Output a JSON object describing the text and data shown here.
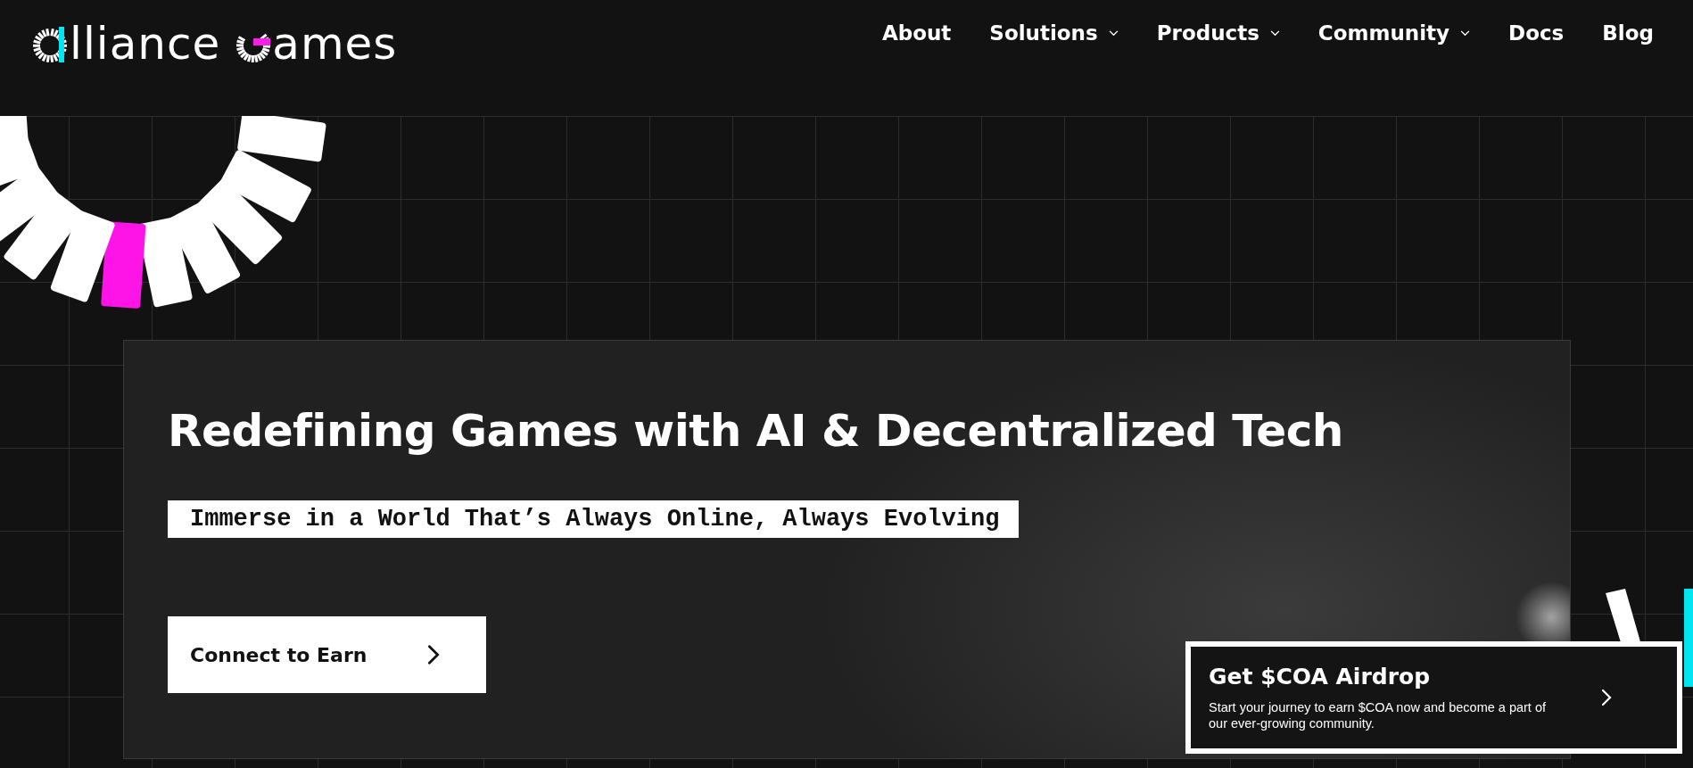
{
  "logo": {
    "part_1": "lliance",
    "part_2": "ames"
  },
  "nav": [
    {
      "label": "About",
      "dropdown": false
    },
    {
      "label": "Solutions",
      "dropdown": true
    },
    {
      "label": "Products",
      "dropdown": true
    },
    {
      "label": "Community",
      "dropdown": true
    },
    {
      "label": "Docs",
      "dropdown": false
    },
    {
      "label": "Blog",
      "dropdown": false
    }
  ],
  "hero": {
    "title": "Redefining Games with AI & Decentralized Tech",
    "subtitle": "Immerse in a World That’s Always Online, Always Evolving",
    "button": "Connect to Earn"
  },
  "airdrop": {
    "title": "Get $COA Airdrop",
    "text": "Start your journey to earn $COA now and become a part of our ever-growing community."
  }
}
